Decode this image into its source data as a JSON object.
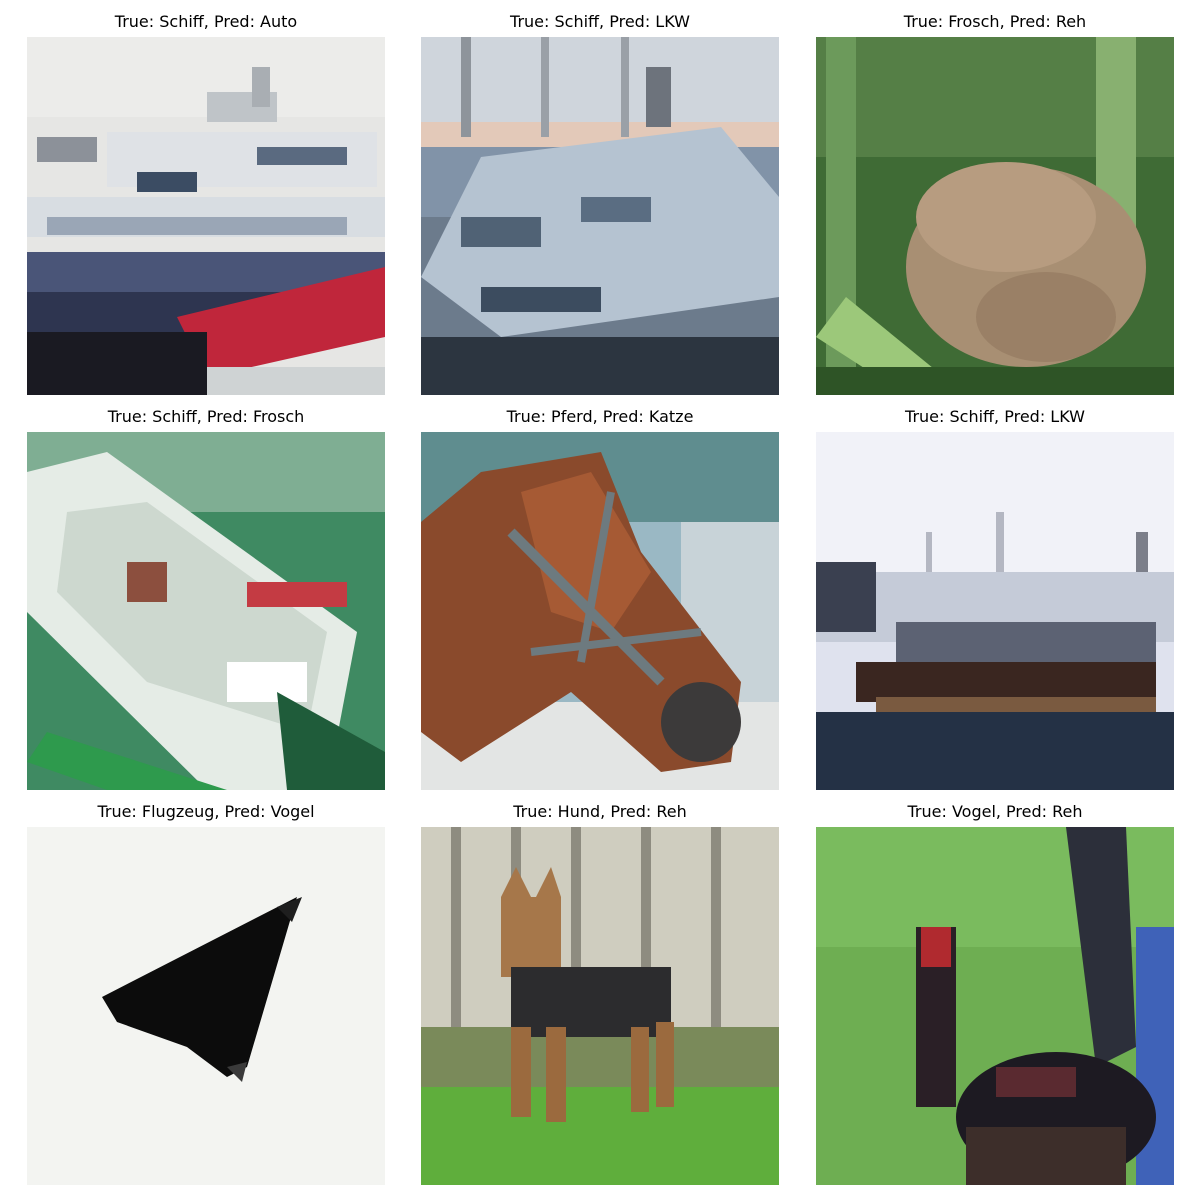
{
  "figure": {
    "cells": [
      {
        "title": "True: Schiff, Pred: Auto",
        "image_icon": "ship-photo-icon"
      },
      {
        "title": "True: Schiff, Pred: LKW",
        "image_icon": "ship-photo-icon"
      },
      {
        "title": "True: Frosch, Pred: Reh",
        "image_icon": "frog-photo-icon"
      },
      {
        "title": "True: Schiff, Pred: Frosch",
        "image_icon": "ship-photo-icon"
      },
      {
        "title": "True: Pferd, Pred: Katze",
        "image_icon": "horse-photo-icon"
      },
      {
        "title": "True: Schiff, Pred: LKW",
        "image_icon": "ship-photo-icon"
      },
      {
        "title": "True: Flugzeug, Pred: Vogel",
        "image_icon": "airplane-photo-icon"
      },
      {
        "title": "True: Hund, Pred: Reh",
        "image_icon": "dog-photo-icon"
      },
      {
        "title": "True: Vogel, Pred: Reh",
        "image_icon": "bird-photo-icon"
      }
    ]
  }
}
